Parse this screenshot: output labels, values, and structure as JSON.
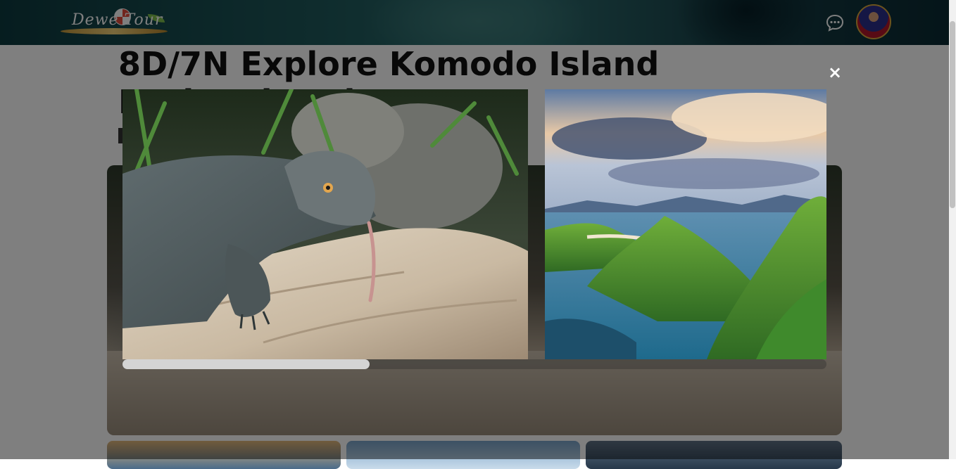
{
  "header": {
    "logo_text": "Dewe Tour",
    "chat_icon": "chat-bubble-icon",
    "avatar_alt": "user avatar"
  },
  "trip": {
    "title": "8D/7N Explore Komodo Island National Park"
  },
  "lightbox": {
    "close_label": "×",
    "scroll_position": 0.35,
    "images": [
      {
        "name": "komodo-dragon-photo"
      },
      {
        "name": "padar-island-landscape-photo"
      }
    ]
  },
  "colors": {
    "overlay": "rgba(0,0,0,0.5)",
    "title_text": "#111111",
    "close_icon": "#ffffff",
    "avatar_ring": "#d9a73a"
  }
}
